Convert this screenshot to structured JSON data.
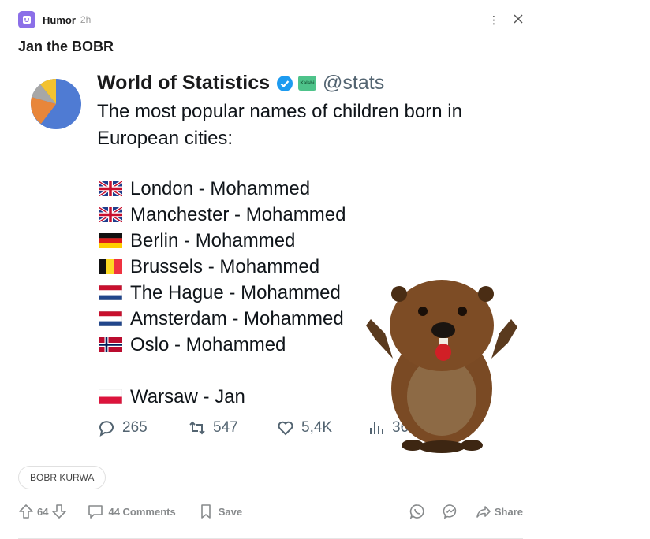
{
  "header": {
    "community": "Humor",
    "time": "2h"
  },
  "post": {
    "title": "Jan the BOBR"
  },
  "tweet": {
    "name": "World of Statistics",
    "sticker": "Kalshi",
    "handle": "@stats",
    "text": "The most popular names of children born in European cities:",
    "rows": [
      {
        "flag": "uk",
        "text": "London - Mohammed"
      },
      {
        "flag": "uk",
        "text": "Manchester - Mohammed"
      },
      {
        "flag": "de",
        "text": "Berlin - Mohammed"
      },
      {
        "flag": "be",
        "text": "Brussels - Mohammed"
      },
      {
        "flag": "nl",
        "text": "The Hague - Mohammed"
      },
      {
        "flag": "nl",
        "text": "Amsterdam - Mohammed"
      },
      {
        "flag": "no",
        "text": "Oslo - Mohammed"
      },
      {
        "flag": "pl",
        "text": "Warsaw - Jan"
      }
    ],
    "stats": {
      "replies": "265",
      "retweets": "547",
      "likes": "5,4K",
      "views": "363"
    }
  },
  "flair": "BOBR KURWA",
  "actions": {
    "votes": "64",
    "comments": "44 Comments",
    "save": "Save",
    "share": "Share"
  },
  "icons": [
    "community-icon",
    "kebab-icon",
    "close-icon",
    "verified-icon",
    "reply-icon",
    "retweet-icon",
    "like-icon",
    "views-icon",
    "upvote-icon",
    "downvote-icon",
    "comment-icon",
    "bookmark-icon",
    "whatsapp-icon",
    "messenger-icon",
    "share-icon"
  ],
  "colors": {
    "community": "#8b6fe8",
    "verified": "#1d9bf0",
    "muted": "#878a8c"
  }
}
